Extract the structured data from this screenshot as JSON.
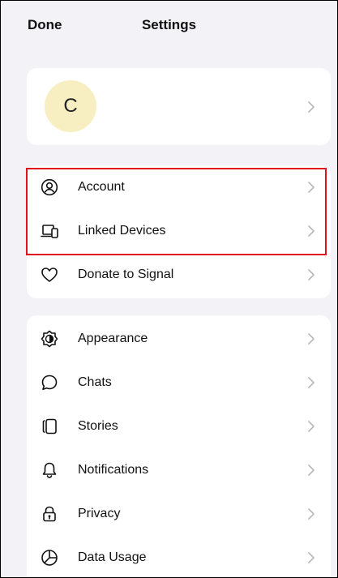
{
  "header": {
    "done_label": "Done",
    "title": "Settings"
  },
  "profile": {
    "avatar_initial": "C"
  },
  "group1": {
    "items": [
      {
        "label": "Account",
        "icon": "account-circle-icon"
      },
      {
        "label": "Linked Devices",
        "icon": "linked-devices-icon"
      },
      {
        "label": "Donate to Signal",
        "icon": "heart-icon"
      }
    ]
  },
  "group2": {
    "items": [
      {
        "label": "Appearance",
        "icon": "appearance-icon"
      },
      {
        "label": "Chats",
        "icon": "chat-bubble-icon"
      },
      {
        "label": "Stories",
        "icon": "stories-icon"
      },
      {
        "label": "Notifications",
        "icon": "bell-icon"
      },
      {
        "label": "Privacy",
        "icon": "lock-icon"
      },
      {
        "label": "Data Usage",
        "icon": "data-usage-icon"
      }
    ]
  },
  "colors": {
    "background": "#f2f2f7",
    "avatar": "#f7efc2",
    "highlight_border": "#e0131c"
  }
}
